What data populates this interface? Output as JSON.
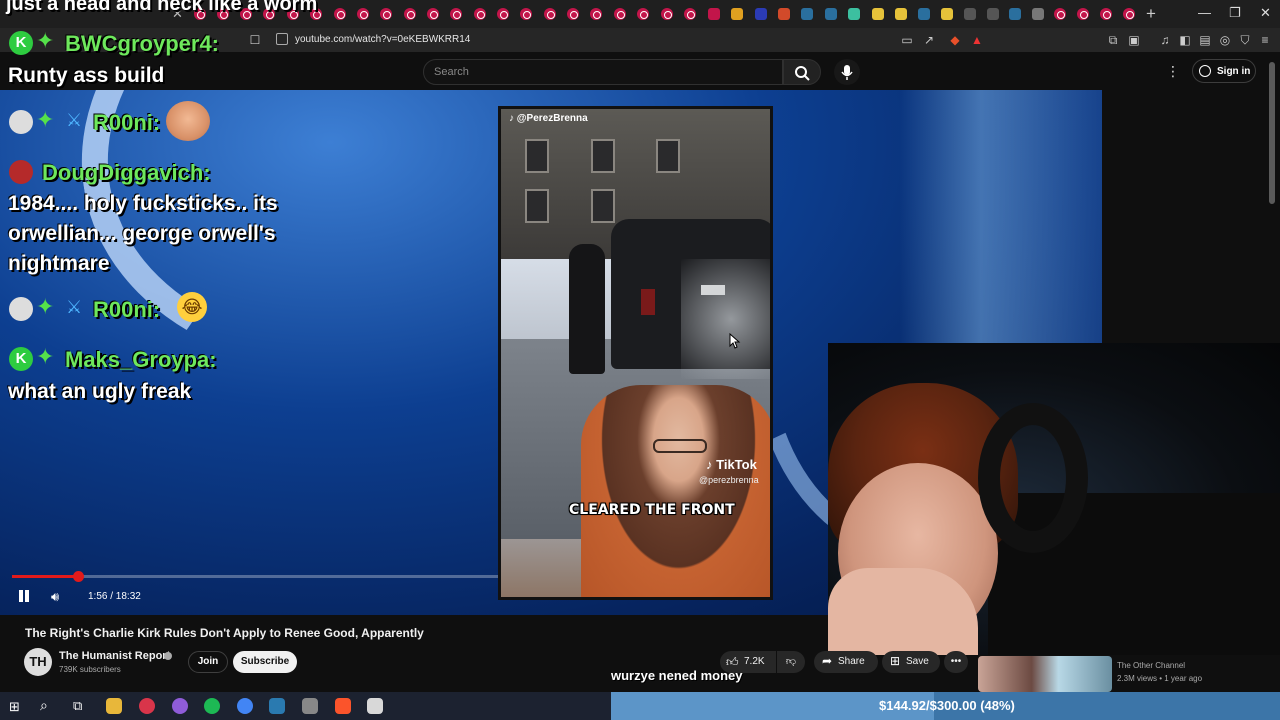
{
  "browser": {
    "url": "youtube.com/watch?v=0eKEBWKRR14"
  },
  "youtube": {
    "search_placeholder": "Search",
    "sign_in_label": "Sign in"
  },
  "tiktok": {
    "handle": "@PerezBrenna",
    "brand": "TikTok",
    "brand_handle": "@perezbrenna",
    "caption": "CLEARED THE FRONT"
  },
  "player": {
    "current_time": "1:56",
    "duration": "18:32",
    "time_display": "1:56 / 18:32",
    "progress_fraction": 0.104
  },
  "chat": {
    "top_overflow": "just a head and neck like a worm",
    "messages": [
      {
        "user": "BWCgroyper4:",
        "text": "Runty ass build",
        "badges": [
          "k-icon",
          "star-icon"
        ]
      },
      {
        "user": "R00ni:",
        "text": "",
        "emote": "face-emote",
        "badges": [
          "skull-icon",
          "star-icon",
          "sword-icon"
        ]
      },
      {
        "user": "DougDiggavich:",
        "text": "1984.... holy fucksticks.. its orwellian... george orwell's nightmare",
        "badges": [
          "red-icon"
        ]
      },
      {
        "user": "R00ni:",
        "text": "",
        "emote": "laughing-emote",
        "badges": [
          "skull-icon",
          "star-icon",
          "sword-icon"
        ]
      },
      {
        "user": "Maks_Groypa:",
        "text": "what an ugly freak",
        "badges": [
          "k-icon",
          "star-icon"
        ]
      }
    ]
  },
  "video": {
    "title": "The Right's Charlie Kirk Rules Don't Apply to Renee Good, Apparently",
    "channel": "The Humanist Report",
    "subscribers": "739K subscribers",
    "join_label": "Join",
    "subscribe_label": "Subscribe",
    "likes": "7.2K",
    "share_label": "Share",
    "save_label": "Save"
  },
  "stream_overlay": {
    "tts_text": "wurzye nened money",
    "goal_text": "$144.92/$300.00 (48%)",
    "goal_fraction": 0.483
  },
  "related": {
    "channel": "The Other Channel",
    "meta": "2.3M views • 1 year ago"
  },
  "colors": {
    "accent_red": "#e21a1a",
    "chat_name_green": "#6ee85c",
    "goal_bar": "#3c75a8"
  }
}
